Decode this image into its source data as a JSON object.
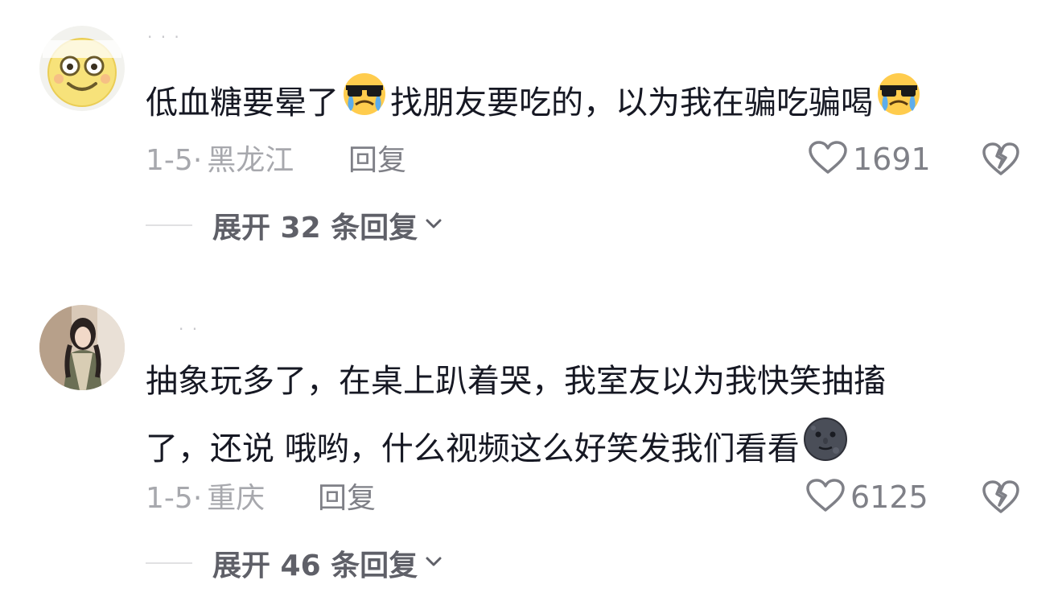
{
  "comments": [
    {
      "username": "· · ·",
      "text": "低血糖要晕了",
      "text_mid": "找朋友要吃的，以为我在骗吃骗喝",
      "emoji_1": "sunglasses-crying-emoji",
      "emoji_2": "sunglasses-crying-emoji",
      "date": "1-5",
      "separator": "·",
      "location": "黑龙江",
      "reply_label": "回复",
      "like_count": "1691",
      "expand_label": "展开 32 条回复"
    },
    {
      "username": "· ·",
      "text_line1": "抽象玩多了，在桌上趴着哭，我室友以为我快笑抽搐",
      "text_line2": "了，还说 哦哟，什么视频这么好笑发我们看看",
      "emoji": "new-moon-face-emoji",
      "date": "1-5",
      "separator": "·",
      "location": "重庆",
      "reply_label": "回复",
      "like_count": "6125",
      "expand_label": "展开 46 条回复"
    }
  ],
  "colors": {
    "text": "#161823",
    "meta": "#a7a8ad",
    "action": "#7f8087",
    "expand": "#5f6068"
  }
}
